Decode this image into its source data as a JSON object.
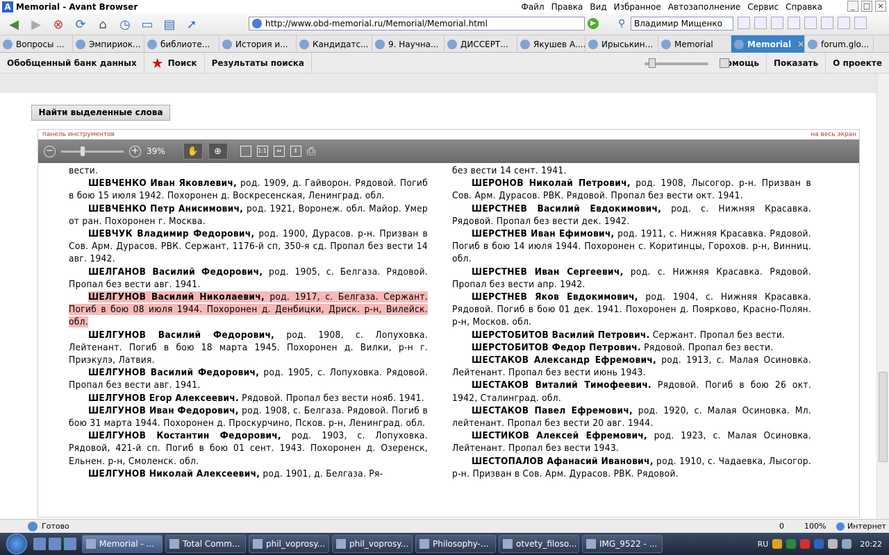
{
  "window": {
    "title": "Memorial - Avant Browser"
  },
  "menu": [
    "Файл",
    "Правка",
    "Вид",
    "Избранное",
    "Автозаполнение",
    "Сервис",
    "Справка"
  ],
  "address": {
    "url": "http://www.obd-memorial.ru/Memorial/Memorial.html"
  },
  "search": {
    "value": "Владимир Мищенко"
  },
  "tabs": [
    {
      "label": "Вопросы ..."
    },
    {
      "label": "Эмпириок..."
    },
    {
      "label": "библиоте..."
    },
    {
      "label": "История и..."
    },
    {
      "label": "Кандидатс..."
    },
    {
      "label": "9. Научна..."
    },
    {
      "label": "ДИССЕРТ..."
    },
    {
      "label": "Якушев А...."
    },
    {
      "label": "Ирыськин..."
    },
    {
      "label": "Memorial"
    },
    {
      "label": "Memorial"
    },
    {
      "label": "forum.glo..."
    }
  ],
  "site_nav": {
    "bank": "Обобщенный банк данных",
    "search": "Поиск",
    "results": "Результаты поиска",
    "help": "Помощь",
    "show": "Показать",
    "about": "О проекте"
  },
  "find_button": "Найти выделенные слова",
  "viewer": {
    "panel_label": "панель инструментов",
    "fullscreen_label": "на весь экран",
    "zoom": "39%"
  },
  "doc": {
    "left": [
      {
        "cont": true,
        "rest": "вести."
      },
      {
        "name": "ШЕВЧЕНКО Иван Яковлевич,",
        "rest": " род. 1909, д. Гайворон. Рядовой. Погиб в бою 15 июля 1942. Похоронен д. Воскресенская, Ленинград. обл."
      },
      {
        "name": "ШЕВЧЕНКО Петр Анисимович,",
        "rest": " род. 1921, Воронеж. обл. Майор. Умер от ран. Похоронен г. Москва."
      },
      {
        "name": "ШЕВЧУК Владимир Федорович,",
        "rest": " род. 1900, Дурасов. р-н. Призван в Сов. Арм. Дурасов. РВК. Сержант, 1176-й сп, 350-я сд. Пропал без вести 14 авг. 1942."
      },
      {
        "name": "ШЕЛГАНОВ Василий Федорович,",
        "rest": " род. 1905, с. Белгаза. Рядовой. Пропал без вести авг. 1941."
      },
      {
        "hl": true,
        "name": "ШЕЛГУНОВ Василий Николаевич,",
        "rest": " род. 1917, с. Белгаза. Сержант. Погиб в бою 08 июля 1944. Похоронен д. Денбицки, Дриск. р-н, Вилейск. обл."
      },
      {
        "name": "ШЕЛГУНОВ Василий Федорович,",
        "rest": " род. 1908, с. Лопуховка. Лейтенант. Погиб в бою 18 марта 1945. Похоронен д. Вилки, р-н г. Приэкулэ, Латвия."
      },
      {
        "name": "ШЕЛГУНОВ Василий Федорович,",
        "rest": " род. 1905, с. Лопуховка. Рядовой. Пропал без вести авг. 1941."
      },
      {
        "name": "ШЕЛГУНОВ Егор Алексеевич.",
        "rest": " Рядовой. Пропал без вести нояб. 1941."
      },
      {
        "name": "ШЕЛГУНОВ Иван Федорович,",
        "rest": " род. 1908, с. Белгаза. Рядовой. Погиб в бою 31 марта 1944. Похоронен д. Проскурчино, Псков. р-н, Ленинград. обл."
      },
      {
        "name": "ШЕЛГУНОВ Костантин Федорович,",
        "rest": " род. 1903, с. Лопуховка. Рядовой, 421-й сп. Погиб в бою 01 сент. 1943. Похоронен д. Озеренск, Ельнен. р-н, Смоленск. обл."
      },
      {
        "name": "ШЕЛГУНОВ Николай Алексеевич,",
        "rest": " род. 1901, д. Белгаза. Ря-"
      }
    ],
    "right": [
      {
        "cont": true,
        "rest": "без вести 14 сент. 1941."
      },
      {
        "name": "ШЕРОНОВ Николай Петрович,",
        "rest": " род. 1908, Лысогор. р-н. Призван в Сов. Арм. Дурасов. РВК. Рядовой. Пропал без вести окт. 1941."
      },
      {
        "name": "ШЕРСТНЕВ Василий Евдокимович,",
        "rest": " род. с. Нижняя Красавка. Рядовой. Пропал без вести дек. 1942."
      },
      {
        "name": "ШЕРСТНЕВ Иван Ефимович,",
        "rest": " род. 1911, с. Нижняя Красавка. Рядовой. Погиб в бою 14 июля 1944. Похоронен с. Коритинцы, Горохов. р-н, Винниц. обл."
      },
      {
        "name": "ШЕРСТНЕВ Иван Сергеевич,",
        "rest": " род. с. Нижняя Красавка. Рядовой. Пропал без вести апр. 1942."
      },
      {
        "name": "ШЕРСТНЕВ Яков Евдокимович,",
        "rest": " род. 1904, с. Нижняя Красавка. Рядовой. Погиб в бою 01 дек. 1941. Похоронен д. Поярково, Красно-Полян. р-н, Москов. обл."
      },
      {
        "name": "ШЕРСТОБИТОВ Василий Петрович.",
        "rest": " Сержант. Пропал без вести."
      },
      {
        "name": "ШЕРСТОБИТОВ Федор Петрович.",
        "rest": " Рядовой. Пропал без вести."
      },
      {
        "name": "ШЕСТАКОВ Александр Ефремович,",
        "rest": " род. 1913, с. Малая Осиновка. Лейтенант. Пропал без вести июнь 1943."
      },
      {
        "name": "ШЕСТАКОВ Виталий Тимофеевич.",
        "rest": " Рядовой. Погиб в бою 26 окт. 1942, Сталинград. обл."
      },
      {
        "name": "ШЕСТАКОВ Павел Ефремович,",
        "rest": " род. 1920, с. Малая Осиновка. Мл. лейтенант. Пропал без вести 20 авг. 1944."
      },
      {
        "name": "ШЕСТИКОВ Алексей Ефремович,",
        "rest": " род. 1923, с. Малая Осиновка. Лейтенант. Пропал без вести 1943."
      },
      {
        "name": "ШЕСТОПАЛОВ Афанасий Иванович,",
        "rest": " род. 1910, с. Чадаевка, Лысогор. р-н. Призван в Сов. Арм. Дурасов. РВК. Рядовой."
      }
    ]
  },
  "status": {
    "text": "Готово",
    "count": "0",
    "zoom": "100%",
    "zone": "Интернет"
  },
  "taskbar": {
    "items": [
      "Memorial - ...",
      "Total Comm...",
      "phil_voprosy...",
      "phil_voprosy...",
      "Philosophy-...",
      "otvety_filoso...",
      "IMG_9522 - ..."
    ],
    "lang": "RU",
    "time": "20:22"
  }
}
